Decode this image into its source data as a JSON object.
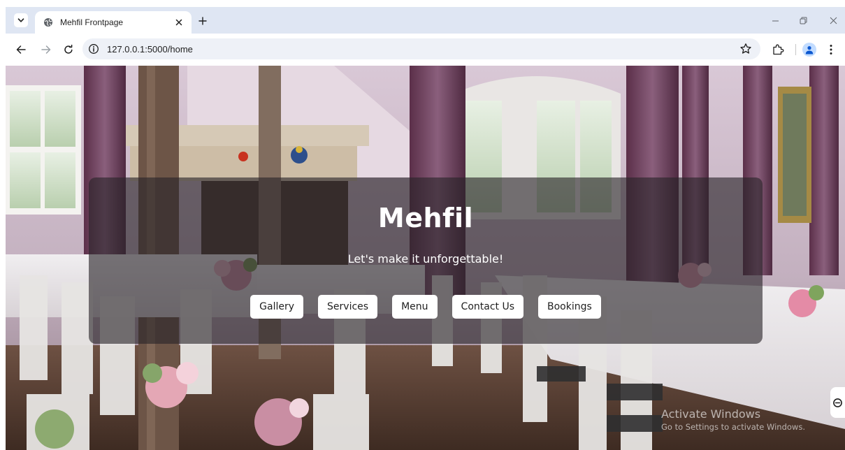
{
  "browser": {
    "tab": {
      "title": "Mehfil Frontpage",
      "favicon": "globe-icon"
    },
    "address_bar": {
      "url": "127.0.0.1:5000/home",
      "security_icon": "info-circle-icon"
    },
    "colors": {
      "tabstrip": "#dfe6f3",
      "omnibox": "#eef1f7",
      "avatar": "#c2dcff",
      "avatar_glyph": "#0b57d0"
    },
    "icons": [
      "chevron-down-icon",
      "close-icon",
      "plus-icon",
      "minimize-icon",
      "restore-icon",
      "arrow-left-icon",
      "arrow-right-icon",
      "reload-icon",
      "star-icon",
      "extensions-icon",
      "person-icon",
      "kebab-icon"
    ]
  },
  "page": {
    "hero": {
      "title": "Mehfil",
      "tagline": "Let's make it unforgettable!",
      "nav": [
        {
          "label": "Gallery"
        },
        {
          "label": "Services"
        },
        {
          "label": "Menu"
        },
        {
          "label": "Contact Us"
        },
        {
          "label": "Bookings"
        }
      ],
      "background": "banquet-hall-photo"
    },
    "watermark": {
      "title": "Activate Windows",
      "subtitle": "Go to Settings to activate Windows."
    }
  }
}
